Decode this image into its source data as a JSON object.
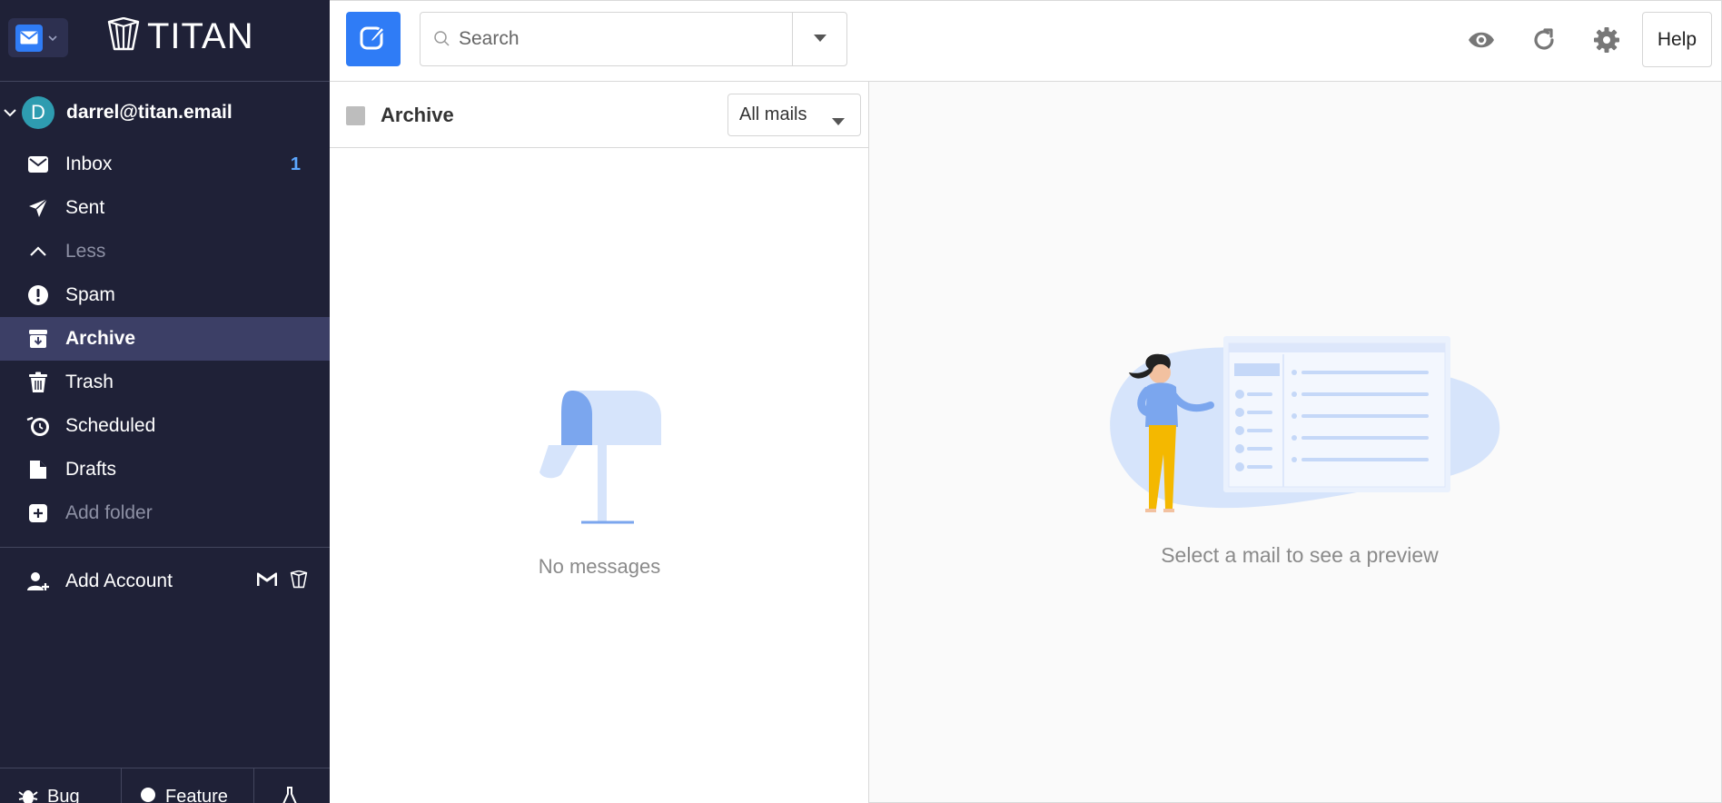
{
  "app": {
    "logo_text": "TITAN"
  },
  "account": {
    "avatar_letter": "D",
    "email": "darrel@titan.email"
  },
  "folders": [
    {
      "label": "Inbox",
      "icon": "envelope-icon",
      "count": "1"
    },
    {
      "label": "Sent",
      "icon": "paper-plane-icon"
    },
    {
      "label": "Less",
      "icon": "chevron-up-icon"
    },
    {
      "label": "Spam",
      "icon": "exclamation-circle-icon"
    },
    {
      "label": "Archive",
      "icon": "archive-icon",
      "active": true
    },
    {
      "label": "Trash",
      "icon": "trash-icon"
    },
    {
      "label": "Scheduled",
      "icon": "scheduled-clock-icon"
    },
    {
      "label": "Drafts",
      "icon": "drafts-icon"
    },
    {
      "label": "Add folder",
      "icon": "plus-square-icon"
    }
  ],
  "add_account": {
    "label": "Add Account"
  },
  "footer": {
    "bug": "Bug",
    "feature": "Feature"
  },
  "search": {
    "placeholder": "Search"
  },
  "toolbar": {
    "help": "Help"
  },
  "list": {
    "title": "Archive",
    "filter": "All mails",
    "empty_text": "No messages"
  },
  "preview": {
    "empty_text": "Select a mail to see a preview"
  },
  "colors": {
    "sidebar_bg": "#1f2137",
    "accent": "#2f7cf6",
    "active_row": "#3c3f66",
    "count": "#5ca7ff"
  }
}
